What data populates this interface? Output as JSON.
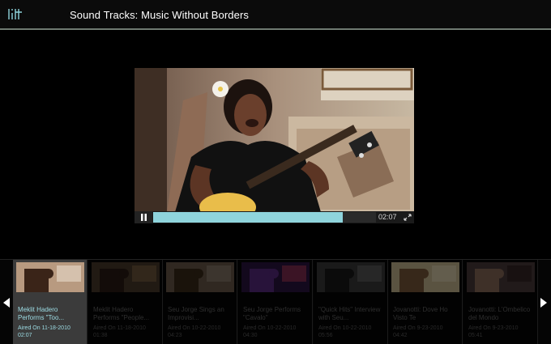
{
  "header": {
    "title": "Sound Tracks: Music Without Borders",
    "logo_icon": "lill-logo-icon"
  },
  "player": {
    "time": "02:07",
    "progress": 0.85,
    "state": "playing"
  },
  "colors": {
    "accent": "#8fd4dc",
    "header_rule": "#6f7b72"
  },
  "playlist": {
    "items": [
      {
        "title": "Meklit Hadero Performs \"Too...",
        "aired": "Aired On 11-18-2010",
        "duration": "02:07"
      },
      {
        "title": "Meklit Hadero Performs \"People...",
        "aired": "Aired On 11-18-2010",
        "duration": "01:38"
      },
      {
        "title": "Seu Jorge Sings an Improvisi...",
        "aired": "Aired On 10-22-2010",
        "duration": "04:23"
      },
      {
        "title": "Seu Jorge Performs \"Cavalo\"",
        "aired": "Aired On 10-22-2010",
        "duration": "04:30"
      },
      {
        "title": "\"Quick Hits\" Interview with Seu...",
        "aired": "Aired On 10-22-2010",
        "duration": "05:56"
      },
      {
        "title": "Jovanotti: Dove Ho Visto Te",
        "aired": "Aired On 9-23-2010",
        "duration": "04:42"
      },
      {
        "title": "Jovanotti: L'Ombelico del Mondo",
        "aired": "Aired On 9-23-2010",
        "duration": "05:41"
      }
    ]
  }
}
